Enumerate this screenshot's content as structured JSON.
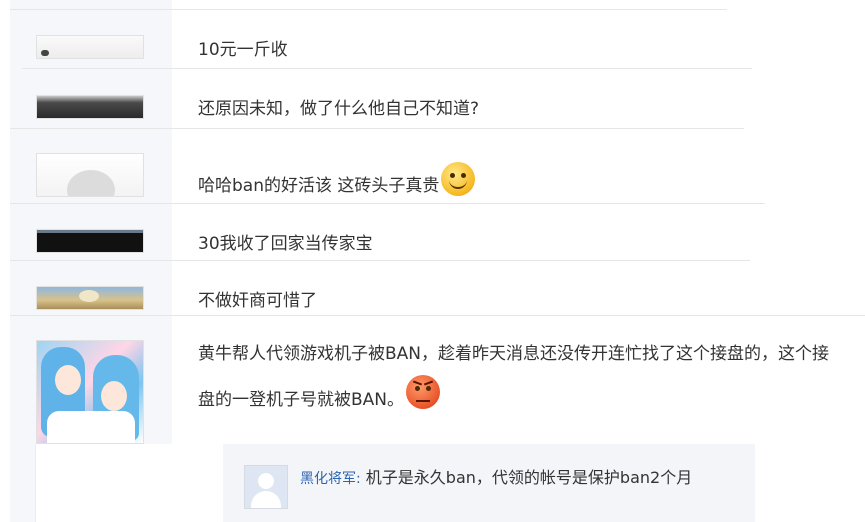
{
  "comments": [
    {
      "text": "10元一斤收",
      "emoji": null
    },
    {
      "text": "还原因未知，做了什么他自己不知道?",
      "emoji": null
    },
    {
      "text": "哈哈ban的好活该 这砖头子真贵",
      "emoji": "smile-emoji"
    },
    {
      "text": "30我收了回家当传家宝",
      "emoji": null
    },
    {
      "text": "不做奸商可惜了",
      "emoji": null
    },
    {
      "text": "黄牛帮人代领游戏机子被BAN，趁着昨天消息还没传开连忙找了这个接盘的，这个接盘的一登机子号就被BAN。",
      "emoji": "angry-emoji"
    }
  ],
  "reply": {
    "username": "黑化将军:",
    "text": " 机子是永久ban，代领的帐号是保护ban2个月"
  }
}
